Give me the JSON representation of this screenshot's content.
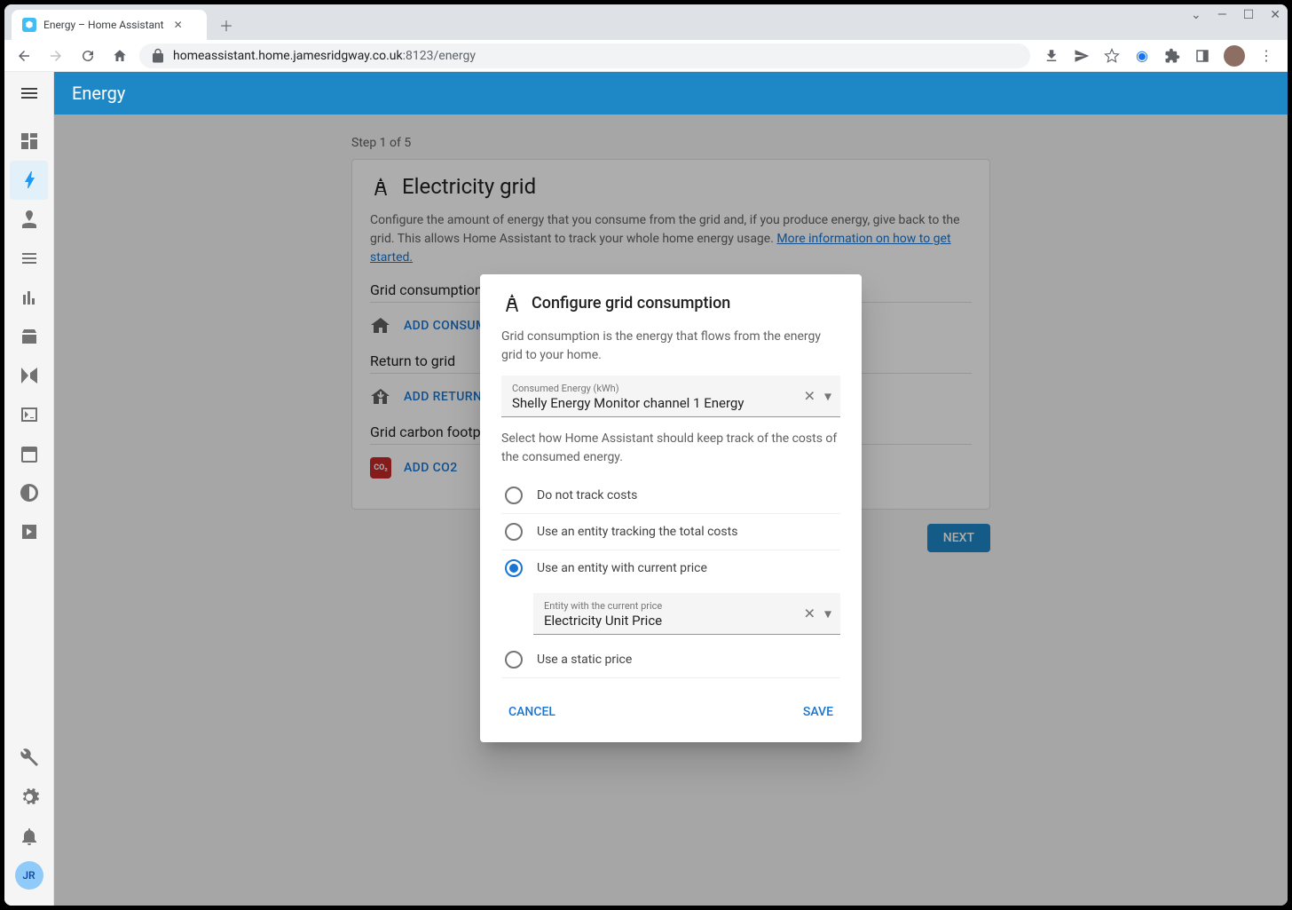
{
  "browser": {
    "tab_title": "Energy – Home Assistant",
    "url_host": "homeassistant.home.jamesridgway.co.uk",
    "url_port": ":8123",
    "url_path": "/energy"
  },
  "header": {
    "title": "Energy"
  },
  "sidebar": {
    "user_initials": "JR"
  },
  "page": {
    "step_label": "Step 1 of 5",
    "card_title": "Electricity grid",
    "card_desc_1": "Configure the amount of energy that you consume from the grid and, if you produce energy, give back to the grid. This allows Home Assistant to track your whole home energy usage.",
    "card_link": "More information on how to get started.",
    "section_consumption": "Grid consumption",
    "add_consumption": "ADD CONSUMPTION",
    "section_return": "Return to grid",
    "add_return": "ADD RETURN",
    "section_carbon": "Grid carbon footprint",
    "add_carbon": "ADD CO2",
    "co2_badge": "CO₂",
    "next": "NEXT"
  },
  "dialog": {
    "title": "Configure grid consumption",
    "intro": "Grid consumption is the energy that flows from the energy grid to your home.",
    "input1_label": "Consumed Energy (kWh)",
    "input1_value": "Shelly Energy Monitor channel 1 Energy",
    "cost_intro": "Select how Home Assistant should keep track of the costs of the consumed energy.",
    "radio1": "Do not track costs",
    "radio2": "Use an entity tracking the total costs",
    "radio3": "Use an entity with current price",
    "radio4": "Use a static price",
    "input2_label": "Entity with the current price",
    "input2_value": "Electricity Unit Price",
    "cancel": "CANCEL",
    "save": "SAVE"
  }
}
